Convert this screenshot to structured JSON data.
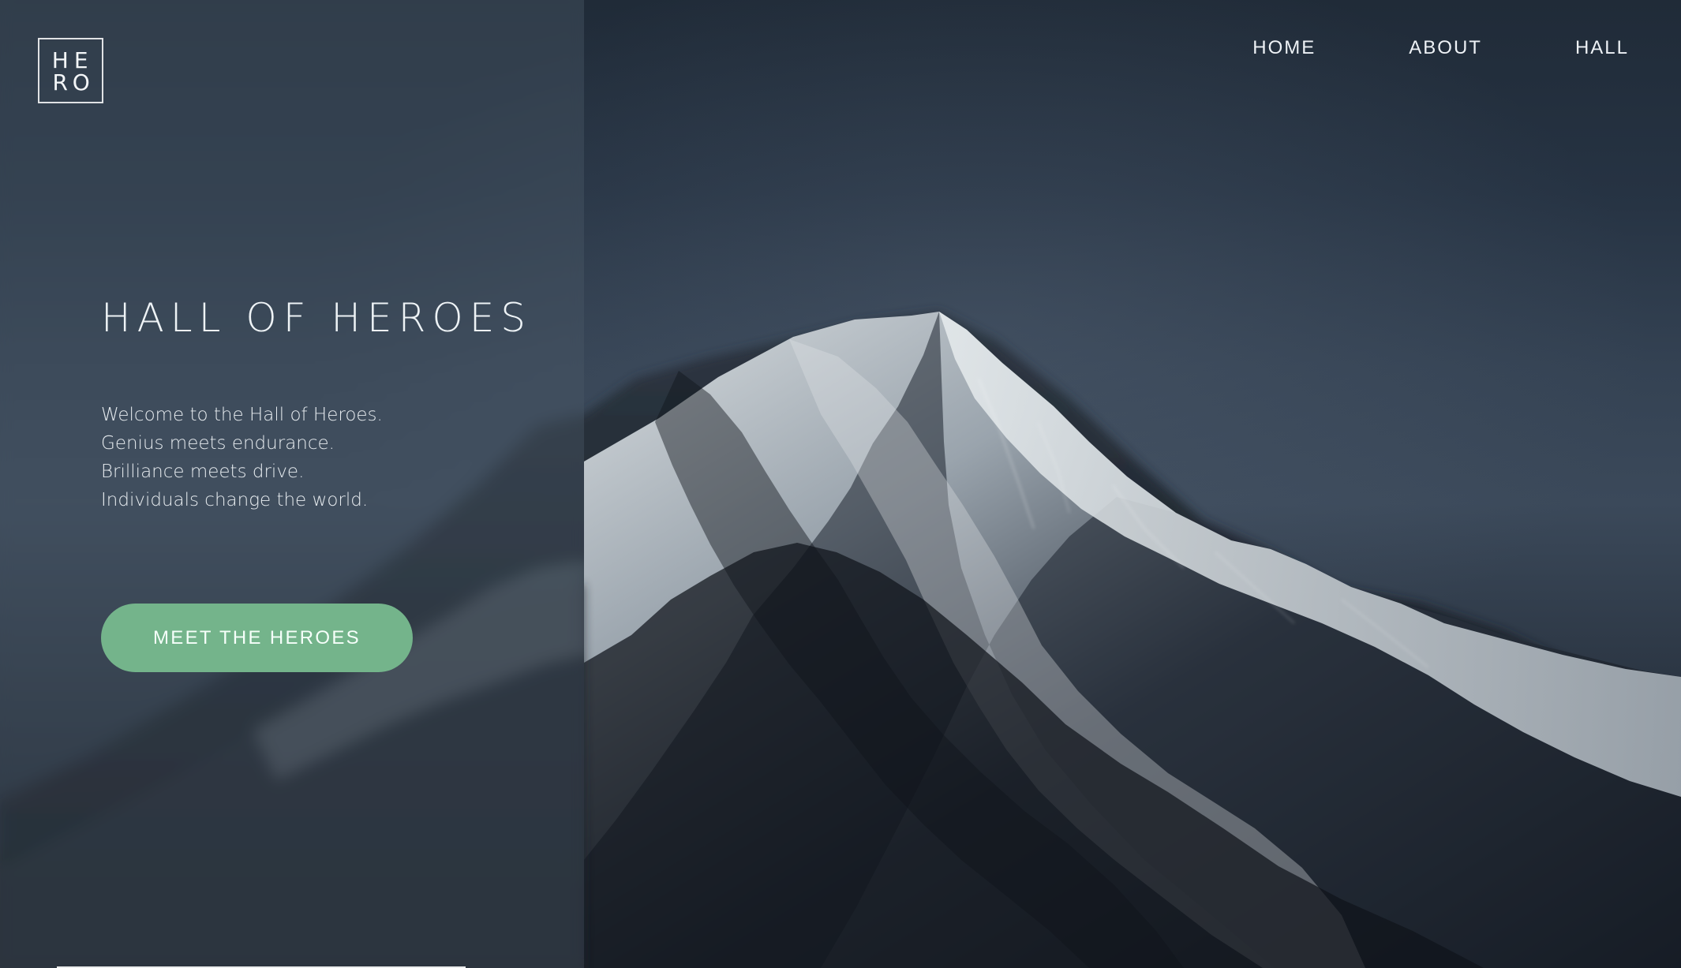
{
  "logo": {
    "letters": [
      "H",
      "E",
      "R",
      "O"
    ]
  },
  "nav": {
    "items": [
      {
        "label": "HOME"
      },
      {
        "label": "ABOUT"
      },
      {
        "label": "HALL"
      }
    ]
  },
  "hero": {
    "title": "HALL OF HEROES",
    "lines": [
      "Welcome to the Hall of Heroes.",
      "Genius meets endurance.",
      "Brilliance meets drive.",
      "Individuals change the world."
    ],
    "cta_label": "MEET THE HEROES"
  },
  "colors": {
    "accent": "#74b48b",
    "panel": "#4b5767",
    "background": "#1b2430",
    "text": "#eef3f6"
  },
  "icons": {
    "logo": "hero-logo-icon"
  }
}
